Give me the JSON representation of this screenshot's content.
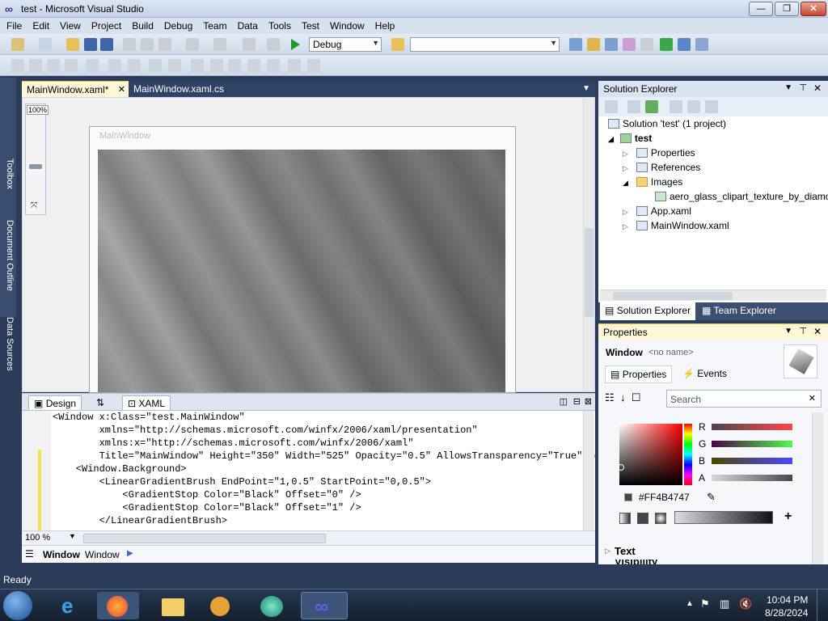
{
  "window": {
    "title": "test - Microsoft Visual Studio",
    "app_icon": "vs-infinity-icon"
  },
  "menu": [
    "File",
    "Edit",
    "View",
    "Project",
    "Build",
    "Debug",
    "Team",
    "Data",
    "Tools",
    "Test",
    "Window",
    "Help"
  ],
  "toolbar": {
    "config": "Debug",
    "platform": ""
  },
  "left_tabs": [
    "Toolbox",
    "Document Outline",
    "Data Sources"
  ],
  "doc_tabs": {
    "active": "MainWindow.xaml*",
    "other": "MainWindow.xaml.cs"
  },
  "designer": {
    "zoom": "100%",
    "window_caption": "MainWindow"
  },
  "split": {
    "design": "Design",
    "swap": "⇅",
    "xaml": "XAML"
  },
  "xaml_lines": [
    "<Window x:Class=\"test.MainWindow\"",
    "        xmlns=\"http://schemas.microsoft.com/winfx/2006/xaml/presentation\"",
    "        xmlns:x=\"http://schemas.microsoft.com/winfx/2006/xaml\"",
    "        Title=\"MainWindow\" Height=\"350\" Width=\"525\" Opacity=\"0.5\" AllowsTransparency=\"True\" Re",
    "    <Window.Background>",
    "        <LinearGradientBrush EndPoint=\"1,0.5\" StartPoint=\"0,0.5\">",
    "            <GradientStop Color=\"Black\" Offset=\"0\" />",
    "            <GradientStop Color=\"Black\" Offset=\"1\" />",
    "        </LinearGradientBrush>"
  ],
  "editor": {
    "zoom": "100 %"
  },
  "breadcrumb": {
    "element": "Window",
    "type": "Window"
  },
  "solution_explorer": {
    "title": "Solution Explorer",
    "items": [
      {
        "label": "Solution 'test' (1 project)"
      },
      {
        "label": "test"
      },
      {
        "label": "Properties"
      },
      {
        "label": "References"
      },
      {
        "label": "Images"
      },
      {
        "label": "aero_glass_clipart_texture_by_diamo"
      },
      {
        "label": "App.xaml"
      },
      {
        "label": "MainWindow.xaml"
      }
    ],
    "tab_solution": "Solution Explorer",
    "tab_team": "Team Explorer"
  },
  "properties": {
    "title": "Properties",
    "element": "Window",
    "name": "<no name>",
    "tab_props": "Properties",
    "tab_events": "Events",
    "search_placeholder": "Search",
    "channels": [
      "R",
      "G",
      "B",
      "A"
    ],
    "hex": "#FF4B4747",
    "section": "Text",
    "section2": "Visibility"
  },
  "status": "Ready",
  "clock": {
    "time": "10:04 PM",
    "date": "8/28/2024"
  },
  "colors": {
    "accent": "#2b3c59",
    "tab_active": "#fdf6d7",
    "selected_item": "#4b4747"
  }
}
